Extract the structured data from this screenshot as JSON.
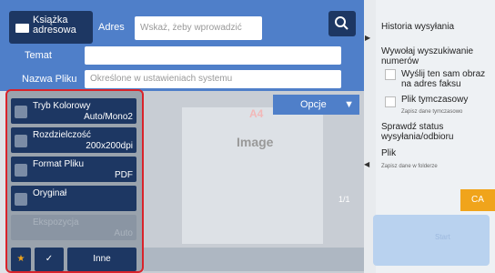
{
  "header": {
    "address_book": "Książka adresowa",
    "address_label": "Adres",
    "address_placeholder": "Wskaż, żeby wprowadzić adres",
    "subject_label": "Temat",
    "filename_label": "Nazwa Pliku",
    "filename_placeholder": "Określone w ustawieniach systemu"
  },
  "preview": {
    "paper_size": "A4",
    "image_label": "Image",
    "page_indicator": "1/1",
    "options_label": "Opcje"
  },
  "left": {
    "color_mode": {
      "title": "Tryb Kolorowy",
      "value": "Auto/Mono2"
    },
    "resolution": {
      "title": "Rozdzielczość",
      "value": "200x200dpi"
    },
    "file_format": {
      "title": "Format Pliku",
      "value": "PDF"
    },
    "original": {
      "title": "Oryginał",
      "value": ""
    },
    "exposure": {
      "title": "Ekspozycja",
      "value": "Auto"
    },
    "other": "Inne"
  },
  "right": {
    "history": "Historia wysyłania",
    "call_search": "Wywołaj wyszukiwanie numerów",
    "send_same": "Wyślij ten sam obraz na adres faksu",
    "temp_file": "Plik tymczasowy",
    "temp_file_sub": "Zapisz dane tymczasowo",
    "check_status": "Sprawdź status wysyłania/odbioru",
    "file": "Plik",
    "file_sub": "Zapisz dane w folderze",
    "ca": "CA",
    "start": "Start"
  },
  "colors": {
    "accent": "#4f7fc9",
    "dark": "#1d3763",
    "highlight": "#d9232b",
    "ca": "#f0a41b"
  }
}
